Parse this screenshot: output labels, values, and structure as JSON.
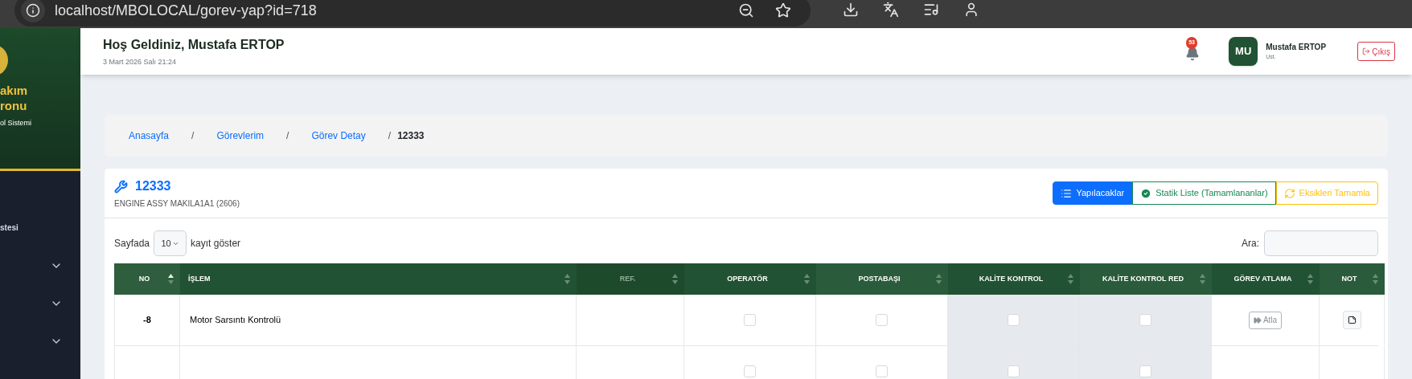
{
  "browser": {
    "url": "localhost/MBOLOCAL/gorev-yap?id=718"
  },
  "sidebar": {
    "brand_lines": [
      "akım",
      "ronu"
    ],
    "subtitle": "ol Sistemi",
    "items": [
      {
        "kind": "link",
        "label": "stesi"
      },
      {
        "kind": "submenu",
        "expanded": false
      },
      {
        "kind": "submenu",
        "expanded": false
      },
      {
        "kind": "submenu",
        "expanded": false
      }
    ]
  },
  "header": {
    "greeting": "Hoş Geldiniz, Mustafa ERTOP",
    "date": "3 Mart 2026 Salı 21:24",
    "notification_count": "53",
    "user": {
      "initials": "MU",
      "name": "Mustafa ERTOP",
      "role": "Ust."
    },
    "logout": "Çıkış"
  },
  "breadcrumb": [
    {
      "label": "Anasayfa",
      "current": false
    },
    {
      "separator": "/",
      "label": "Görevlerim",
      "current": false
    },
    {
      "separator": "/",
      "label": "Görev Detay",
      "current": false
    },
    {
      "separator": "/",
      "label": "12333",
      "current": true
    }
  ],
  "task": {
    "title": "12333",
    "subtitle": "ENGINE ASSY MAKILA1A1 (2606)",
    "views": [
      {
        "kind": "list",
        "label": "Yapılacaklar",
        "selected": true,
        "color": "#0d6efd"
      },
      {
        "kind": "check",
        "label": "Statik Liste (Tamamlananlar)",
        "selected": false,
        "color": "#198754"
      },
      {
        "kind": "sync",
        "label": "Eksikleri Tamamla",
        "selected": false,
        "color": "#ffc107"
      }
    ]
  },
  "length": {
    "prefix": "Sayfada",
    "value": "10",
    "suffix": "kayıt göster"
  },
  "search": {
    "label": "Ara:"
  },
  "table": {
    "columns": [
      {
        "label": "NO",
        "sorted": true,
        "disabled": false,
        "shaded": false
      },
      {
        "label": "İŞLEM",
        "sorted": false,
        "disabled": false,
        "shaded": false
      },
      {
        "label": "REF.",
        "sorted": false,
        "disabled": true,
        "shaded": false
      },
      {
        "label": "OPERATÖR",
        "sorted": false,
        "disabled": false,
        "shaded": false
      },
      {
        "label": "POSTABAŞI",
        "sorted": false,
        "disabled": false,
        "shaded": false
      },
      {
        "label": "KALİTE KONTROL",
        "sorted": false,
        "disabled": false,
        "shaded": true
      },
      {
        "label": "KALİTE KONTROL RED",
        "sorted": false,
        "disabled": false,
        "shaded": true
      },
      {
        "label": "GÖREV ATLAMA",
        "sorted": false,
        "disabled": false,
        "shaded": false
      },
      {
        "label": "NOT",
        "sorted": false,
        "disabled": false,
        "shaded": false
      }
    ],
    "rows": [
      {
        "no": "-8",
        "islem": "Motor Sarsıntı Kontrolü",
        "checks": [
          false,
          false,
          false,
          false
        ],
        "skip": "Atla"
      },
      {
        "checks": [
          false,
          false,
          false,
          false
        ]
      }
    ]
  }
}
